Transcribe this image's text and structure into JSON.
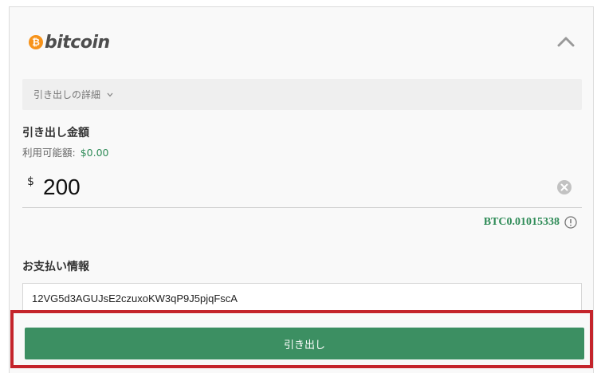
{
  "header": {
    "logo_mark": "₿",
    "logo_text": "bitcoin",
    "collapse_icon": "chevron-up-icon"
  },
  "details": {
    "label": "引き出しの詳細",
    "icon": "chevron-down-icon"
  },
  "amount": {
    "title": "引き出し金額",
    "available_label": "利用可能額:",
    "available_value": "$0.00",
    "currency_symbol": "$",
    "value": "200",
    "clear_icon": "clear-circle-icon",
    "btc_equivalent": "BTC0.01015338",
    "info_icon": "info-icon"
  },
  "payment": {
    "title": "お支払い情報",
    "address": "12VG5d3AGUJsE2czuxoKW3qP9J5pjqFscA"
  },
  "actions": {
    "withdraw_label": "引き出し"
  },
  "colors": {
    "accent_green": "#3c8f62",
    "balance_green": "#2e8b57",
    "highlight_red": "#c4242b",
    "bitcoin_orange": "#f7931a"
  }
}
